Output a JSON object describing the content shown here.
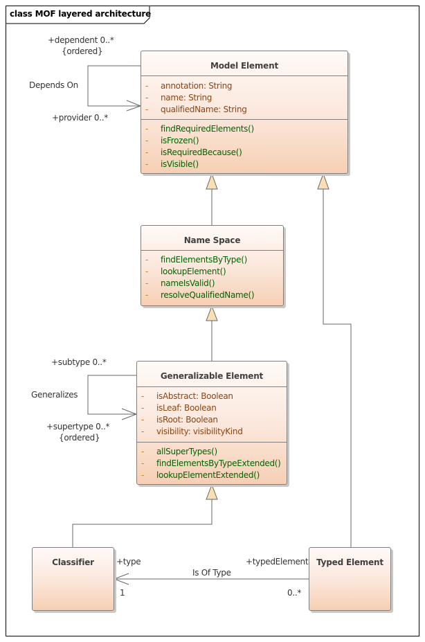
{
  "diagram": {
    "title": "class MOF layered architecture"
  },
  "classes": {
    "model_element": {
      "name": "Model Element",
      "attributes": [
        {
          "visibility": "-",
          "text": "annotation: String"
        },
        {
          "visibility": "-",
          "text": "name: String"
        },
        {
          "visibility": "-",
          "text": "qualifiedName: String"
        }
      ],
      "operations": [
        {
          "visibility": "-",
          "text": "findRequiredElements()"
        },
        {
          "visibility": "-",
          "text": "isFrozen()"
        },
        {
          "visibility": "-",
          "text": "isRequiredBecause()"
        },
        {
          "visibility": "-",
          "text": "isVisible()"
        }
      ]
    },
    "name_space": {
      "name": "Name Space",
      "operations": [
        {
          "visibility": "-",
          "text": "findElementsByType()"
        },
        {
          "visibility": "-",
          "text": "lookupElement()"
        },
        {
          "visibility": "-",
          "text": "nameIsValid()"
        },
        {
          "visibility": "-",
          "text": "resolveQualifiedName()"
        }
      ]
    },
    "generalizable_element": {
      "name": "Generalizable Element",
      "attributes": [
        {
          "visibility": "-",
          "text": "isAbstract: Boolean"
        },
        {
          "visibility": "-",
          "text": "isLeaf: Boolean"
        },
        {
          "visibility": "-",
          "text": "isRoot: Boolean"
        },
        {
          "visibility": "-",
          "text": "visibility: visibilityKind"
        }
      ],
      "operations": [
        {
          "visibility": "-",
          "text": "allSuperTypes()"
        },
        {
          "visibility": "-",
          "text": "findElementsByTypeExtended()"
        },
        {
          "visibility": "-",
          "text": "lookupElementExtended()"
        }
      ]
    },
    "classifier": {
      "name": "Classifier"
    },
    "typed_element": {
      "name": "Typed Element"
    }
  },
  "associations": {
    "depends_on": {
      "name": "Depends On",
      "source_role": "+dependent 0..*",
      "source_constraint": "{ordered}",
      "target_role": "+provider 0..*"
    },
    "generalizes": {
      "name": "Generalizes",
      "source_role": "+subtype 0..*",
      "target_role": "+supertype 0..*",
      "target_constraint": "{ordered}"
    },
    "is_of_type": {
      "name": "Is Of Type",
      "type_role": "+type",
      "type_multiplicity": "1",
      "typed_role": "+typedElement",
      "typed_multiplicity": "0..*"
    }
  },
  "colors": {
    "frame": "#000000",
    "class_border": "#7f7f7f",
    "class_fill_top": "#fffaf7",
    "class_fill_bottom": "#f6cfb4",
    "attribute_text": "#8b4513",
    "operation_text": "#006400",
    "generalization_arrow_fill": "#f9deb6"
  }
}
